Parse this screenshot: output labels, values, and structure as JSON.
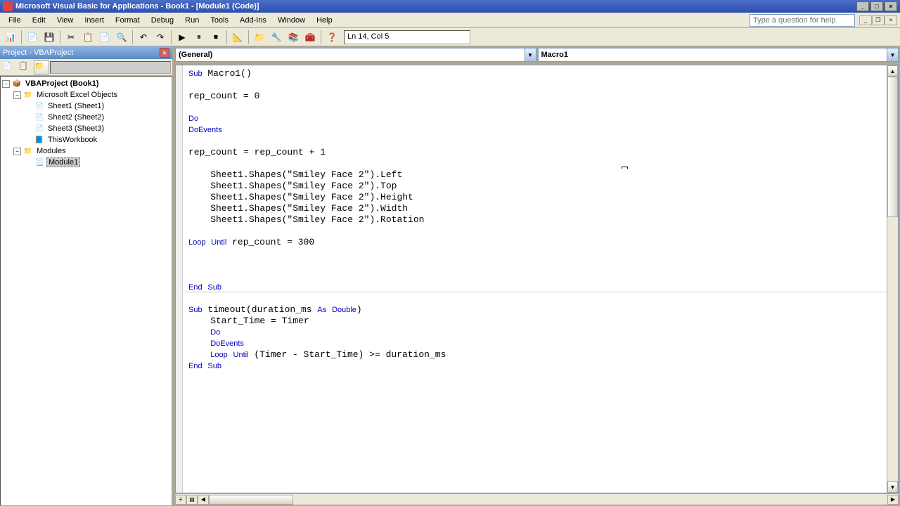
{
  "title": "Microsoft Visual Basic for Applications - Book1 - [Module1 (Code)]",
  "menu": {
    "file": "File",
    "edit": "Edit",
    "view": "View",
    "insert": "Insert",
    "format": "Format",
    "debug": "Debug",
    "run": "Run",
    "tools": "Tools",
    "addins": "Add-Ins",
    "window": "Window",
    "help": "Help"
  },
  "help_placeholder": "Type a question for help",
  "status": "Ln 14, Col 5",
  "panel_title": "Project - VBAProject",
  "tree": {
    "root": "VBAProject (Book1)",
    "excel_objects": "Microsoft Excel Objects",
    "sheet1": "Sheet1 (Sheet1)",
    "sheet2": "Sheet2 (Sheet2)",
    "sheet3": "Sheet3 (Sheet3)",
    "thisworkbook": "ThisWorkbook",
    "modules": "Modules",
    "module1": "Module1"
  },
  "dropdowns": {
    "object": "(General)",
    "proc": "Macro1"
  },
  "code": "Sub Macro1()\n\nrep_count = 0\n\nDo\nDoEvents\n\nrep_count = rep_count + 1\n\n    Sheet1.Shapes(\"Smiley Face 2\").Left\n    Sheet1.Shapes(\"Smiley Face 2\").Top\n    Sheet1.Shapes(\"Smiley Face 2\").Height\n    Sheet1.Shapes(\"Smiley Face 2\").Width\n    Sheet1.Shapes(\"Smiley Face 2\").Rotation\n\nLoop Until rep_count = 300\n\n\n\nEnd Sub\n\nSub timeout(duration_ms As Double)\n    Start_Time = Timer\n    Do\n    DoEvents\n    Loop Until (Timer - Start_Time) >= duration_ms\nEnd Sub"
}
